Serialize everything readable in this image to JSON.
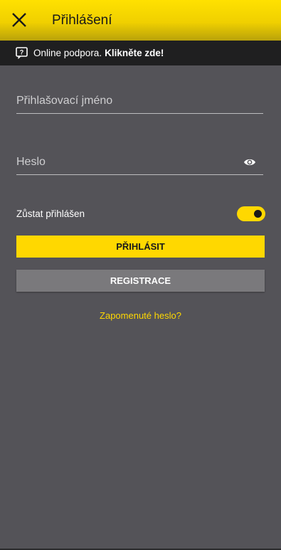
{
  "header": {
    "title": "Přihlášení",
    "close_icon": "close-icon",
    "background": "#ffe100"
  },
  "support": {
    "icon": "help-message-icon",
    "text": "Online podpora.",
    "link": "Klikněte zde!"
  },
  "form": {
    "username_placeholder": "Přihlašovací jméno",
    "username_value": "",
    "password_placeholder": "Heslo",
    "password_value": "",
    "password_toggle_icon": "eye-icon",
    "stay_logged_in_label": "Zůstat přihlášen",
    "stay_logged_in_on": true,
    "login_button": "PŘIHLÁSIT",
    "register_button": "REGISTRACE",
    "forgot_password": "Zapomenuté heslo?"
  },
  "colors": {
    "accent": "#ffd800",
    "background": "#545358",
    "support_bar": "#1f1f20",
    "register_button": "#7a797c"
  }
}
